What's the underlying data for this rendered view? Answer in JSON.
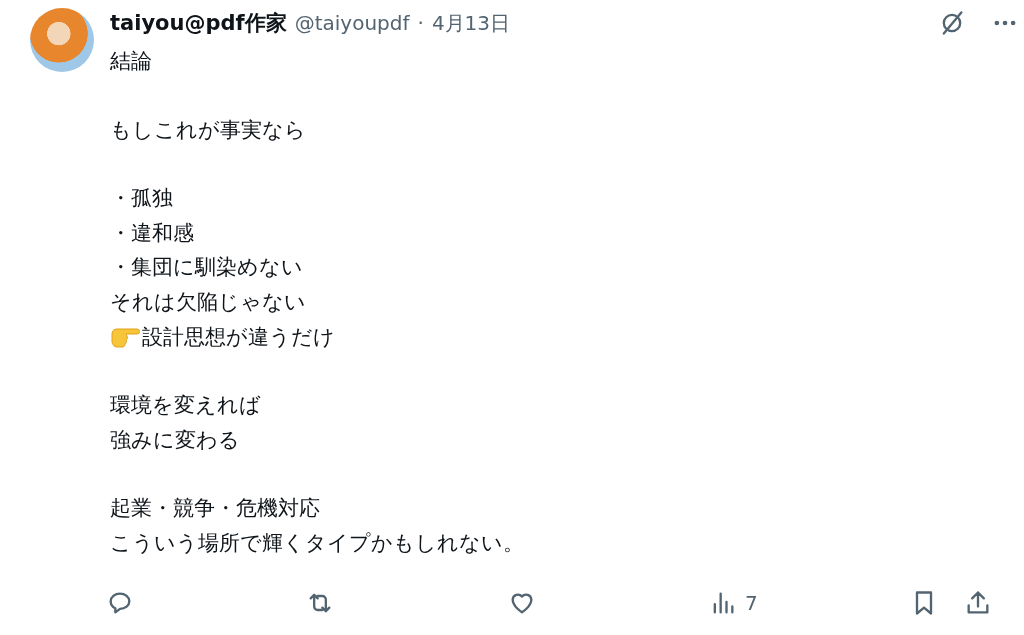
{
  "author": {
    "name": "taiyou@pdf作家",
    "handle": "@taiyoupdf",
    "separator": "·",
    "date": "4月13日"
  },
  "paragraphs": [
    {
      "lines": [
        {
          "text": "結論"
        }
      ]
    },
    {
      "lines": [
        {
          "text": "もしこれが事実なら"
        }
      ]
    },
    {
      "lines": [
        {
          "text": "・孤独"
        },
        {
          "text": "・違和感"
        },
        {
          "text": "・集団に馴染めない"
        },
        {
          "text": "それは欠陥じゃない"
        },
        {
          "text": "設計思想が違うだけ",
          "pointer": true
        }
      ]
    },
    {
      "lines": [
        {
          "text": "環境を変えれば"
        },
        {
          "text": "強みに変わる"
        }
      ]
    },
    {
      "lines": [
        {
          "text": "起業・競争・危機対応"
        },
        {
          "text": "こういう場所で輝くタイプかもしれない。"
        }
      ]
    }
  ],
  "actions": [
    {
      "kind": "reply"
    },
    {
      "kind": "repost"
    },
    {
      "kind": "like"
    },
    {
      "kind": "views",
      "count": "7"
    },
    {
      "kind": "bookmark"
    },
    {
      "kind": "share"
    }
  ]
}
